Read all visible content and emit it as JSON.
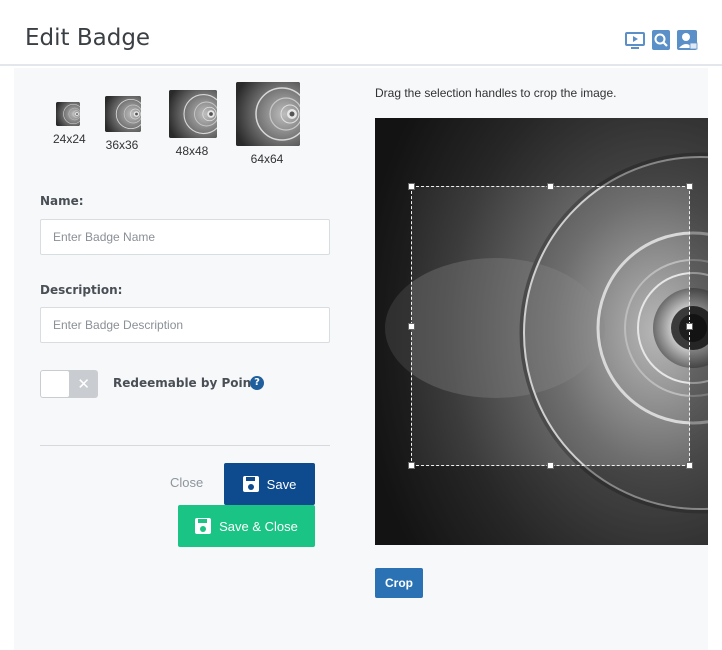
{
  "header": {
    "title": "Edit Badge",
    "icons": [
      "video-icon",
      "search-page-icon",
      "user-card-icon"
    ],
    "icon_color": "#5b8fc7"
  },
  "thumbnails": [
    {
      "label": "24x24"
    },
    {
      "label": "36x36"
    },
    {
      "label": "48x48"
    },
    {
      "label": "64x64"
    }
  ],
  "form": {
    "name_label": "Name:",
    "name_placeholder": "Enter Badge Name",
    "description_label": "Description:",
    "description_placeholder": "Enter Badge Description",
    "redeemable_label": "Redeemable by Points",
    "redeemable_enabled": false,
    "help_glyph": "?"
  },
  "actions": {
    "close_label": "Close",
    "save_label": "Save",
    "save_close_label": "Save & Close",
    "save_color": "#0e4a8e",
    "save_close_color": "#1ac484"
  },
  "cropper": {
    "instructions": "Drag the selection handles to crop the image.",
    "crop_label": "Crop",
    "crop_color": "#2b72b5"
  }
}
